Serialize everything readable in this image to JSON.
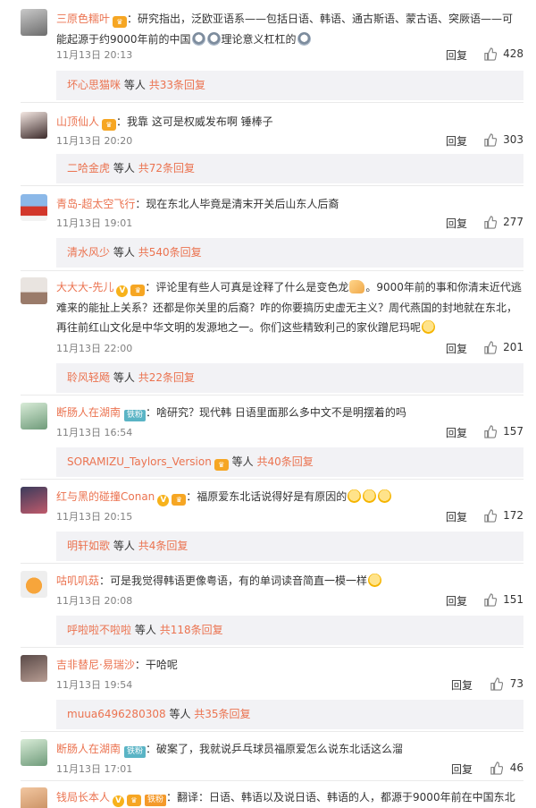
{
  "comments": [
    {
      "user": "三原色糯叶",
      "badge": "crown",
      "text": "：研究指出，泛欧亚语系——包括日语、韩语、通古斯语、蒙古语、突厥语——可能起源于约9000年前的中国",
      "trail_emojis": [
        "sad",
        "sad"
      ],
      "text2": "理论意义杠杠的",
      "end_emoji": "sad",
      "date": "11月13日 20:13",
      "reply_label": "回复",
      "likes": "428",
      "sub_user": "坏心思猫咪",
      "sub_text": "等人",
      "sub_count": "共33条回复"
    },
    {
      "user": "山顶仙人",
      "badge": "crown",
      "text": "：我靠 这可是权威发布啊 锤棒子",
      "date": "11月13日 20:20",
      "reply_label": "回复",
      "likes": "303",
      "sub_user": "二哈金虎",
      "sub_text": "等人",
      "sub_count": "共72条回复"
    },
    {
      "user": "青岛-超太空飞行",
      "text": "：现在东北人毕竟是清末开关后山东人后裔",
      "date": "11月13日 19:01",
      "reply_label": "回复",
      "likes": "277",
      "sub_user": "清水风少",
      "sub_text": "等人",
      "sub_count": "共540条回复"
    },
    {
      "user": "大大大-先儿",
      "vip": "V",
      "badge": "crown",
      "text": "：评论里有些人可真是诠释了什么是变色龙",
      "text_after": "。9000年前的事和你清末近代逃难来的能扯上关系？还都是你关里的后裔？咋的你要搞历史虚无主义？周代燕国的封地就在东北，再往前红山文化是中华文明的发源地之一。你们这些精致利己的家伙蹭尼玛呢",
      "date": "11月13日 22:00",
      "reply_label": "回复",
      "likes": "201",
      "sub_user": "聆风轻飏",
      "sub_text": "等人",
      "sub_count": "共22条回复"
    },
    {
      "user": "断肠人在湖南",
      "fans": "铁粉",
      "text": "：啥研究？现代韩 日语里面那么多中文不是明摆着的吗",
      "date": "11月13日 16:54",
      "reply_label": "回复",
      "likes": "157",
      "sub_user": "SORAMIZU_Taylors_Version",
      "sub_badge": "crown",
      "sub_text": "等人",
      "sub_count": "共40条回复"
    },
    {
      "user": "红与黑的碰撞Conan",
      "vip": "V",
      "badge": "crown",
      "text": "：福原爱东北话说得好是有原因的",
      "date": "11月13日 20:15",
      "reply_label": "回复",
      "likes": "172",
      "sub_user": "明轩如歌",
      "sub_text": "等人",
      "sub_count": "共4条回复"
    },
    {
      "user": "咕叽叽菇",
      "text": "：可是我觉得韩语更像粤语，有的单词读音简直一模一样",
      "date": "11月13日 20:08",
      "reply_label": "回复",
      "likes": "151",
      "sub_user": "呼啦啦不啦啦",
      "sub_text": "等人",
      "sub_count": "共118条回复"
    },
    {
      "user": "吉非替尼·易瑞沙",
      "text": "：干哈呢",
      "date": "11月13日 19:54",
      "reply_label": "回复",
      "likes": "73",
      "sub_user": "muua6496280308",
      "sub_text": "等人",
      "sub_count": "共35条回复"
    },
    {
      "user": "断肠人在湖南",
      "fans": "铁粉",
      "text": "：破案了，我就说乒乓球员福原爱怎么说东北话这么溜",
      "date": "11月13日 17:01",
      "reply_label": "回复",
      "likes": "46"
    },
    {
      "user": "钱局长本人",
      "vip": "V",
      "badge": "crown",
      "fans": "铁粉",
      "text": "：翻译：日语、韩语以及说日语、韩语的人，都源于9000年前在中国东北种"
    }
  ],
  "colors": {
    "username": "#eb7350",
    "fans_badge": "#5ab4c5",
    "sub_bg": "#f2f2f5"
  }
}
